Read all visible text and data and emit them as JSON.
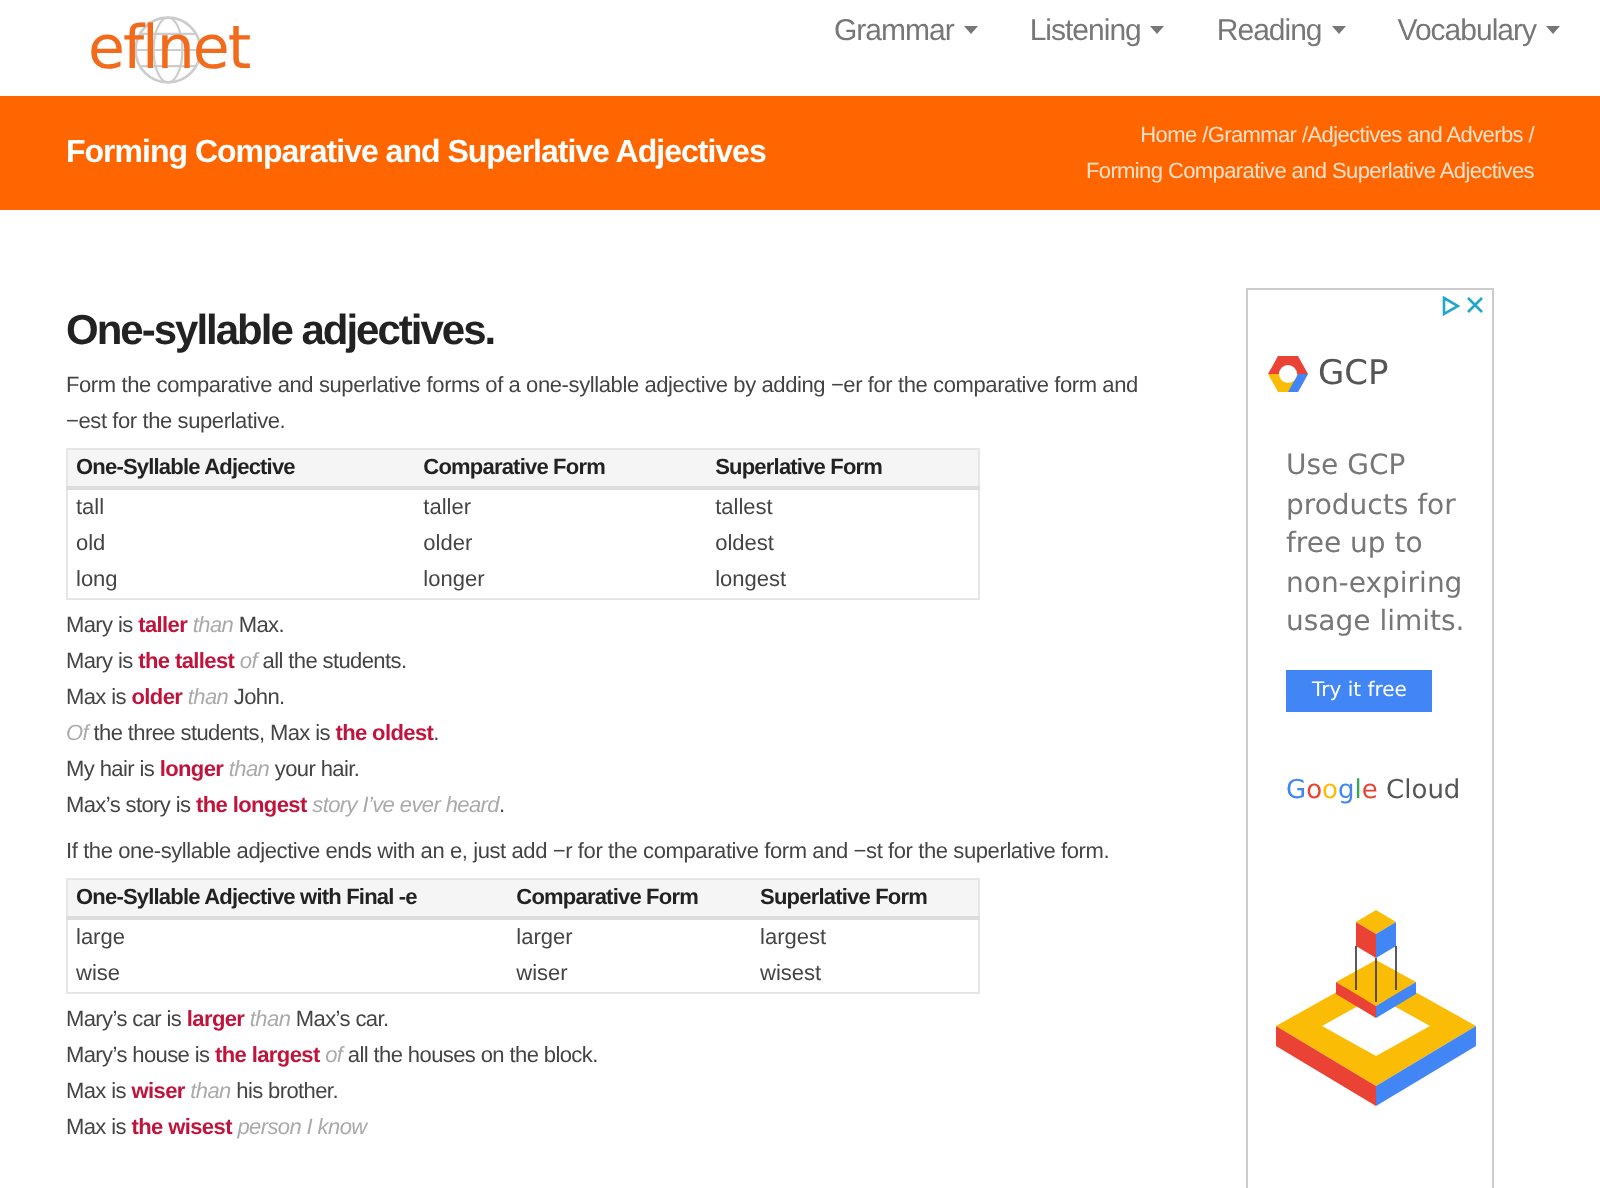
{
  "header": {
    "logo": "eflnet",
    "nav": [
      {
        "label": "Grammar"
      },
      {
        "label": "Listening"
      },
      {
        "label": "Reading"
      },
      {
        "label": "Vocabulary"
      }
    ]
  },
  "banner": {
    "title": "Forming Comparative and Superlative Adjectives",
    "separator": "/",
    "breadcrumb": [
      {
        "label": "Home",
        "kind": "link"
      },
      {
        "label": "Grammar",
        "kind": "link"
      },
      {
        "label": "Adjectives and Adverbs",
        "kind": "link"
      },
      {
        "label": "Forming Comparative and Superlative Adjectives",
        "kind": "current"
      }
    ]
  },
  "content": {
    "heading": "One-syllable adjectives.",
    "sections": [
      {
        "intro": "Form the comparative and superlative forms of a one-syllable adjective by adding −er for the comparative form and −est for the superlative.",
        "table": {
          "columns": [
            "One-Syllable Adjective",
            "Comparative Form",
            "Superlative Form"
          ],
          "rows": [
            [
              "tall",
              "taller",
              "tallest"
            ],
            [
              "old",
              "older",
              "oldest"
            ],
            [
              "long",
              "longer",
              "longest"
            ]
          ]
        },
        "examples": [
          [
            {
              "kind": "plain",
              "text": "Mary is "
            },
            {
              "kind": "key",
              "text": "taller"
            },
            {
              "kind": "hint",
              "text": " than "
            },
            {
              "kind": "plain",
              "text": "Max."
            }
          ],
          [
            {
              "kind": "plain",
              "text": "Mary is "
            },
            {
              "kind": "key",
              "text": "the tallest"
            },
            {
              "kind": "hint",
              "text": " of "
            },
            {
              "kind": "plain",
              "text": "all the students."
            }
          ],
          [
            {
              "kind": "plain",
              "text": "Max is "
            },
            {
              "kind": "key",
              "text": "older"
            },
            {
              "kind": "hint",
              "text": " than "
            },
            {
              "kind": "plain",
              "text": "John."
            }
          ],
          [
            {
              "kind": "hint",
              "text": "Of "
            },
            {
              "kind": "plain",
              "text": "the three students, Max is "
            },
            {
              "kind": "key",
              "text": "the oldest"
            },
            {
              "kind": "plain",
              "text": "."
            }
          ],
          [
            {
              "kind": "plain",
              "text": "My hair is "
            },
            {
              "kind": "key",
              "text": "longer"
            },
            {
              "kind": "hint",
              "text": " than "
            },
            {
              "kind": "plain",
              "text": "your hair."
            }
          ],
          [
            {
              "kind": "plain",
              "text": "Max’s story is "
            },
            {
              "kind": "key",
              "text": "the longest"
            },
            {
              "kind": "hint",
              "text": " story I’ve ever heard"
            },
            {
              "kind": "plain",
              "text": "."
            }
          ]
        ]
      },
      {
        "intro": "If the one-syllable adjective ends with an e, just add −r for the comparative form and −st for the superlative form.",
        "table": {
          "columns": [
            "One-Syllable Adjective with Final -e",
            "Comparative Form",
            "Superlative Form"
          ],
          "rows": [
            [
              "large",
              "larger",
              "largest"
            ],
            [
              "wise",
              "wiser",
              "wisest"
            ]
          ]
        },
        "examples": [
          [
            {
              "kind": "plain",
              "text": "Mary’s car is "
            },
            {
              "kind": "key",
              "text": "larger"
            },
            {
              "kind": "hint",
              "text": " than "
            },
            {
              "kind": "plain",
              "text": "Max’s car."
            }
          ],
          [
            {
              "kind": "plain",
              "text": "Mary’s house is "
            },
            {
              "kind": "key",
              "text": "the largest"
            },
            {
              "kind": "hint",
              "text": " of "
            },
            {
              "kind": "plain",
              "text": "all the houses on the block."
            }
          ],
          [
            {
              "kind": "plain",
              "text": "Max is "
            },
            {
              "kind": "key",
              "text": "wiser"
            },
            {
              "kind": "hint",
              "text": " than "
            },
            {
              "kind": "plain",
              "text": "his brother."
            }
          ],
          [
            {
              "kind": "plain",
              "text": "Max is "
            },
            {
              "kind": "key",
              "text": "the wisest"
            },
            {
              "kind": "hint",
              "text": " person I know"
            }
          ]
        ]
      }
    ]
  },
  "ad": {
    "brand": "GCP",
    "headline": "Use GCP products for free up to non-expiring usage limits.",
    "button": "Try it free",
    "logo_word": "Google",
    "logo_suffix": "Cloud"
  }
}
